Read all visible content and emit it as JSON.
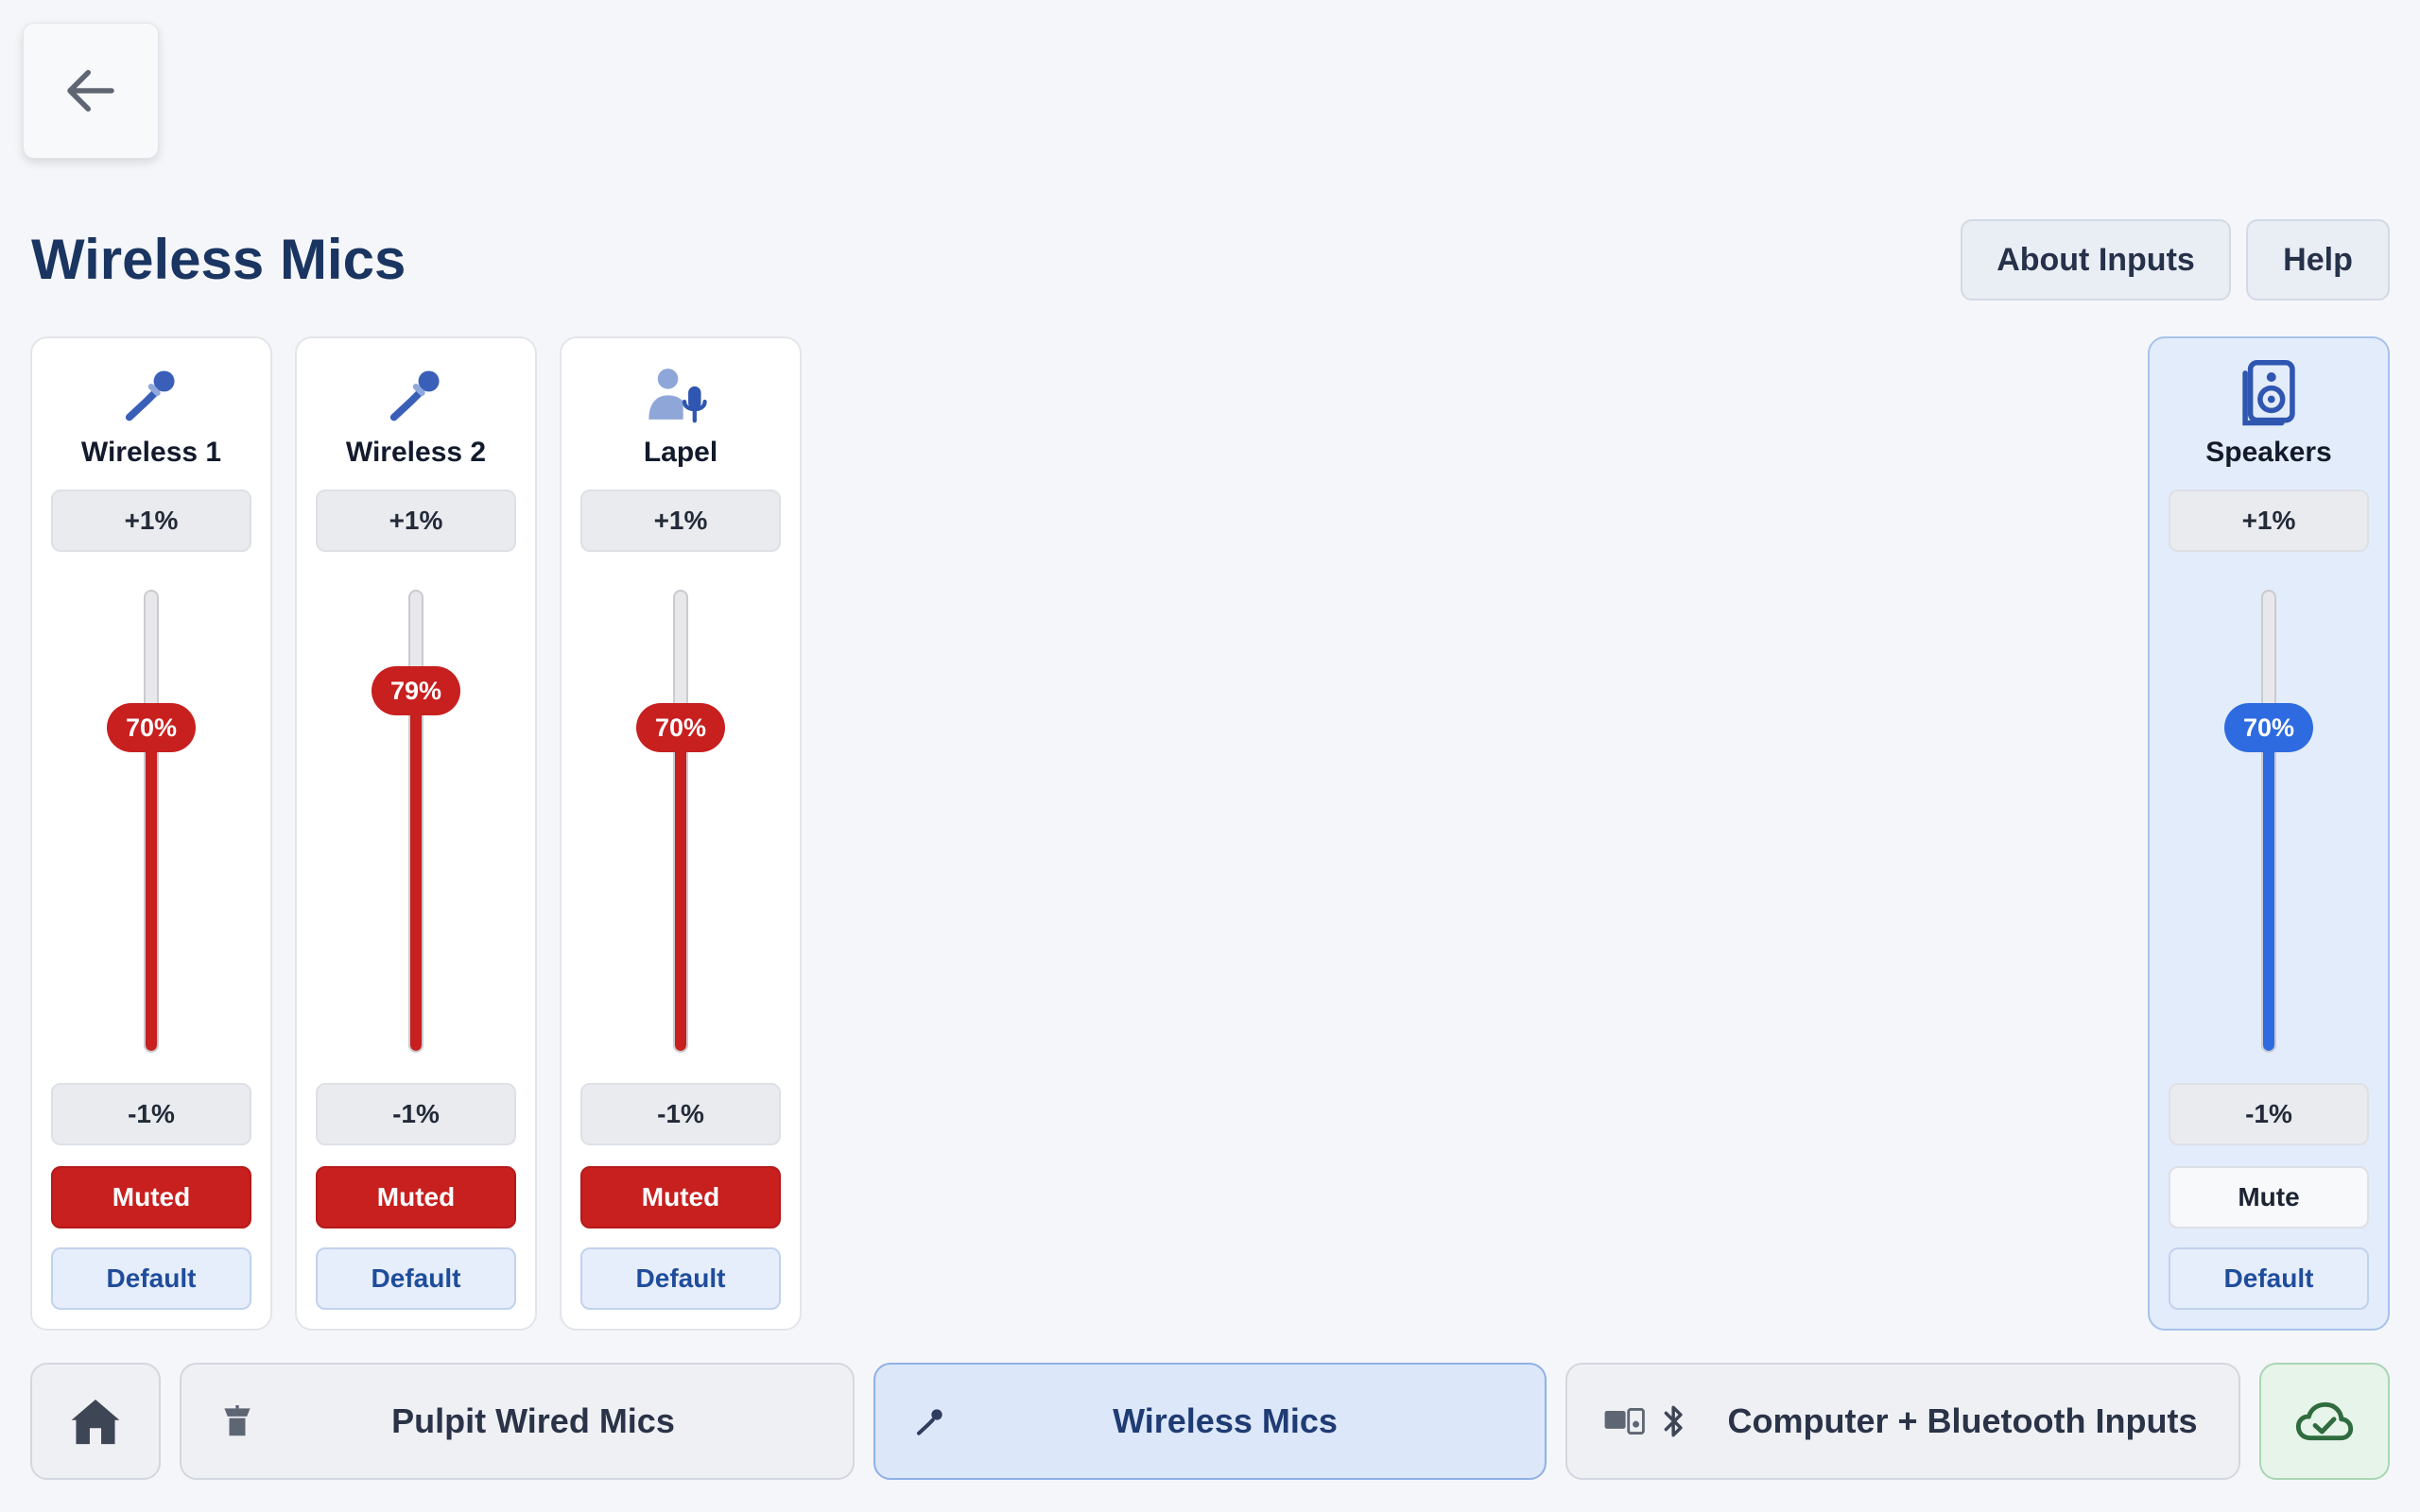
{
  "page": {
    "title": "Wireless Mics"
  },
  "header": {
    "about_label": "About Inputs",
    "help_label": "Help"
  },
  "accent_colors": {
    "muted": "#c81f1f",
    "output": "#2e6be0",
    "active_nav": "#dce7fa"
  },
  "strips": [
    {
      "name": "Wireless 1",
      "icon": "microphone-icon",
      "level_percent": 70,
      "level_label": "70%",
      "up_label": "+1%",
      "down_label": "-1%",
      "mute_label": "Muted",
      "muted": true,
      "default_label": "Default"
    },
    {
      "name": "Wireless 2",
      "icon": "microphone-icon",
      "level_percent": 79,
      "level_label": "79%",
      "up_label": "+1%",
      "down_label": "-1%",
      "mute_label": "Muted",
      "muted": true,
      "default_label": "Default"
    },
    {
      "name": "Lapel",
      "icon": "lapel-mic-person-icon",
      "level_percent": 70,
      "level_label": "70%",
      "up_label": "+1%",
      "down_label": "-1%",
      "mute_label": "Muted",
      "muted": true,
      "default_label": "Default"
    },
    {
      "name": "Speakers",
      "icon": "speaker-icon",
      "level_percent": 70,
      "level_label": "70%",
      "up_label": "+1%",
      "down_label": "-1%",
      "mute_label": "Mute",
      "muted": false,
      "default_label": "Default"
    }
  ],
  "nav": [
    {
      "label": "",
      "icon": "home-icon"
    },
    {
      "label": "Pulpit Wired Mics",
      "icon": "podium-icon"
    },
    {
      "label": "Wireless Mics",
      "icon": "microphone-icon",
      "active": true
    },
    {
      "label": "Computer + Bluetooth Inputs",
      "icon": "computer-bluetooth-icon"
    },
    {
      "label": "",
      "icon": "cloud-check-icon"
    }
  ]
}
